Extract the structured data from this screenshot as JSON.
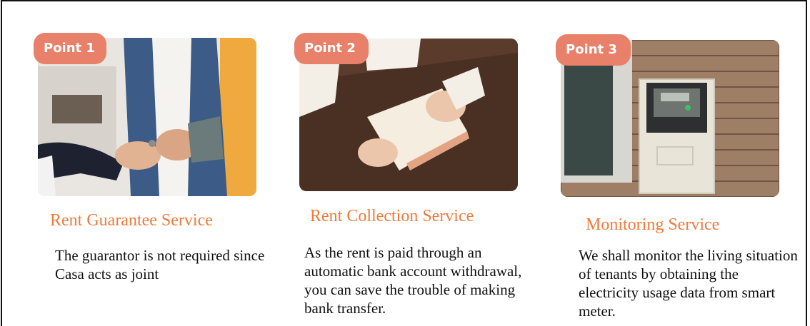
{
  "cards": [
    {
      "badge": "Point 1",
      "title": "Rent Guarantee Service",
      "description": "The guarantor is not required since Casa acts as joint",
      "photo_icon": "key-handover-photo"
    },
    {
      "badge": "Point 2",
      "title": "Rent Collection Service",
      "description": "As the rent is paid through an automatic bank account withdrawal, you can save the trouble of making bank transfer.",
      "photo_icon": "bankbook-photo"
    },
    {
      "badge": "Point 3",
      "title": "Monitoring Service",
      "description": "We shall monitor the living situation of tenants by obtaining the electricity usage data from smart meter.",
      "photo_icon": "smart-meter-photo"
    }
  ],
  "colors": {
    "badge": "#e8806a",
    "title": "#ef7a3a",
    "text": "#111111"
  }
}
